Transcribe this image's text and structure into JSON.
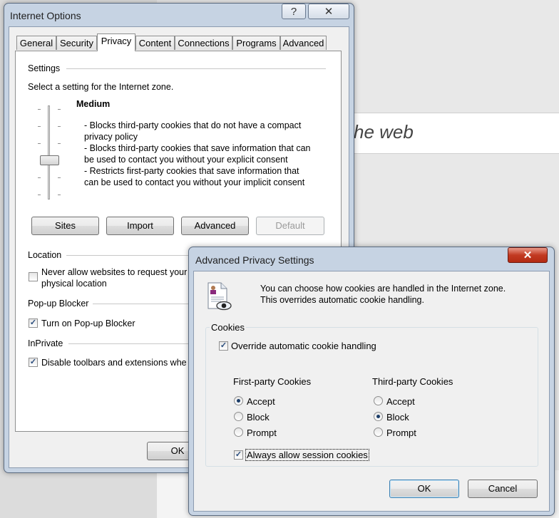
{
  "background": {
    "search_text": "he web"
  },
  "internet_options": {
    "title": "Internet Options",
    "tabs": [
      "General",
      "Security",
      "Privacy",
      "Content",
      "Connections",
      "Programs",
      "Advanced"
    ],
    "active_tab": "Privacy",
    "settings_group": "Settings",
    "zone_prompt": "Select a setting for the Internet zone.",
    "level_name": "Medium",
    "level_lines": [
      "- Blocks third-party cookies that do not have a compact",
      "privacy policy",
      "- Blocks third-party cookies that save information that can",
      "be used to contact you without your explicit consent",
      "- Restricts first-party cookies that save information that",
      "can be used to contact you without your implicit consent"
    ],
    "buttons": {
      "sites": "Sites",
      "import": "Import",
      "advanced": "Advanced",
      "default": "Default"
    },
    "location_group": "Location",
    "location_checkbox": {
      "line1": "Never allow websites to request your",
      "line2": "physical location",
      "checked": false
    },
    "popup_group": "Pop-up Blocker",
    "popup_checkbox": {
      "label": "Turn on Pop-up Blocker",
      "checked": true
    },
    "inprivate_group": "InPrivate",
    "inprivate_checkbox": {
      "label": "Disable toolbars and extensions whe",
      "checked": true
    },
    "ok_button": "OK"
  },
  "advanced_privacy": {
    "title": "Advanced Privacy Settings",
    "close_icon": "close-icon",
    "description_line1": "You can choose how cookies are handled in the Internet zone.",
    "description_line2": "This overrides automatic cookie handling.",
    "cookies_group": "Cookies",
    "override": {
      "label": "Override automatic cookie handling",
      "checked": true
    },
    "first_party": {
      "heading": "First-party Cookies",
      "options": [
        "Accept",
        "Block",
        "Prompt"
      ],
      "selected": "Accept"
    },
    "third_party": {
      "heading": "Third-party Cookies",
      "options": [
        "Accept",
        "Block",
        "Prompt"
      ],
      "selected": "Block"
    },
    "session": {
      "label": "Always allow session cookies",
      "checked": true
    },
    "ok_button": "OK",
    "cancel_button": "Cancel"
  },
  "colors": {
    "window_frame": "#c6d3e3",
    "close_button": "#c23a22",
    "check_mark": "#2a4d7d"
  }
}
